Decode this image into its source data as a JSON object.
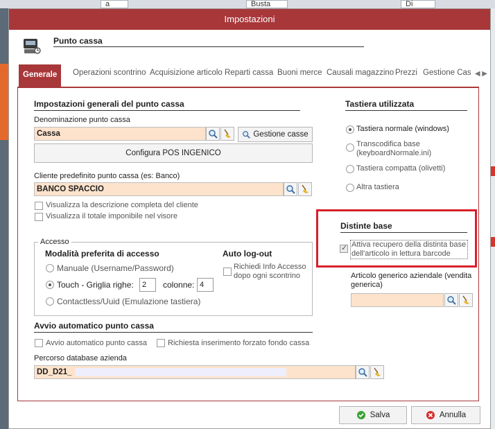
{
  "background": {
    "tiles": [
      "a",
      "Busta",
      "Di"
    ]
  },
  "dialog": {
    "title": "Impostazioni",
    "header_title": "Punto cassa"
  },
  "tabs": [
    "Generale",
    "Operazioni scontrino",
    "Acquisizione articolo",
    "Reparti cassa",
    "Buoni merce",
    "Causali magazzino",
    "Prezzi",
    "Gestione Cass"
  ],
  "general": {
    "section_title": "Impostazioni generali del punto cassa",
    "denominazione_label": "Denominazione punto cassa",
    "denominazione_value": "Cassa",
    "gestione_casse": "Gestione casse",
    "configura_pos": "Configura POS INGENICO",
    "cliente_label": "Cliente predefinito punto cassa (es: Banco)",
    "cliente_value": "BANCO SPACCIO",
    "cb_descrizione": "Visualizza la descrizione completa del cliente",
    "cb_totale": "Visualizza il totale imponibile nel visore"
  },
  "accesso": {
    "legend": "Accesso",
    "modalita_title": "Modalità preferita di accesso",
    "manuale": "Manuale (Username/Password)",
    "touch": "Touch - Griglia righe:",
    "righe_value": "2",
    "colonne_label": "colonne:",
    "colonne_value": "4",
    "contactless": "Contactless/Uuid (Emulazione tastiera)",
    "autologout_title": "Auto log-out",
    "richiedi_info": "Richiedi Info Accesso dopo ogni scontrino"
  },
  "avvio": {
    "section_title": "Avvio automatico punto cassa",
    "cb_avvio": "Avvio automatico punto cassa",
    "cb_fondo": "Richiesta inserimento forzato fondo cassa",
    "percorso_label": "Percorso database azienda",
    "percorso_value": "DD_D21_"
  },
  "tastiera": {
    "section_title": "Tastiera utilizzata",
    "normale": "Tastiera normale (windows)",
    "transcodifica": "Transcodifica base (keyboardNormale.ini)",
    "compatta": "Tastiera compatta (olivetti)",
    "altra": "Altra tastiera"
  },
  "distinte": {
    "section_title": "Distinte base",
    "cb_attiva": "Attiva recupero della distinta base dell'articolo in lettura barcode",
    "articolo_label": "Articolo generico aziendale (vendita generica)",
    "articolo_value": ""
  },
  "footer": {
    "salva": "Salva",
    "annulla": "Annulla"
  },
  "colors": {
    "accent": "#a8373a",
    "field_bg": "#fde3cc",
    "highlight": "#d8202b"
  }
}
